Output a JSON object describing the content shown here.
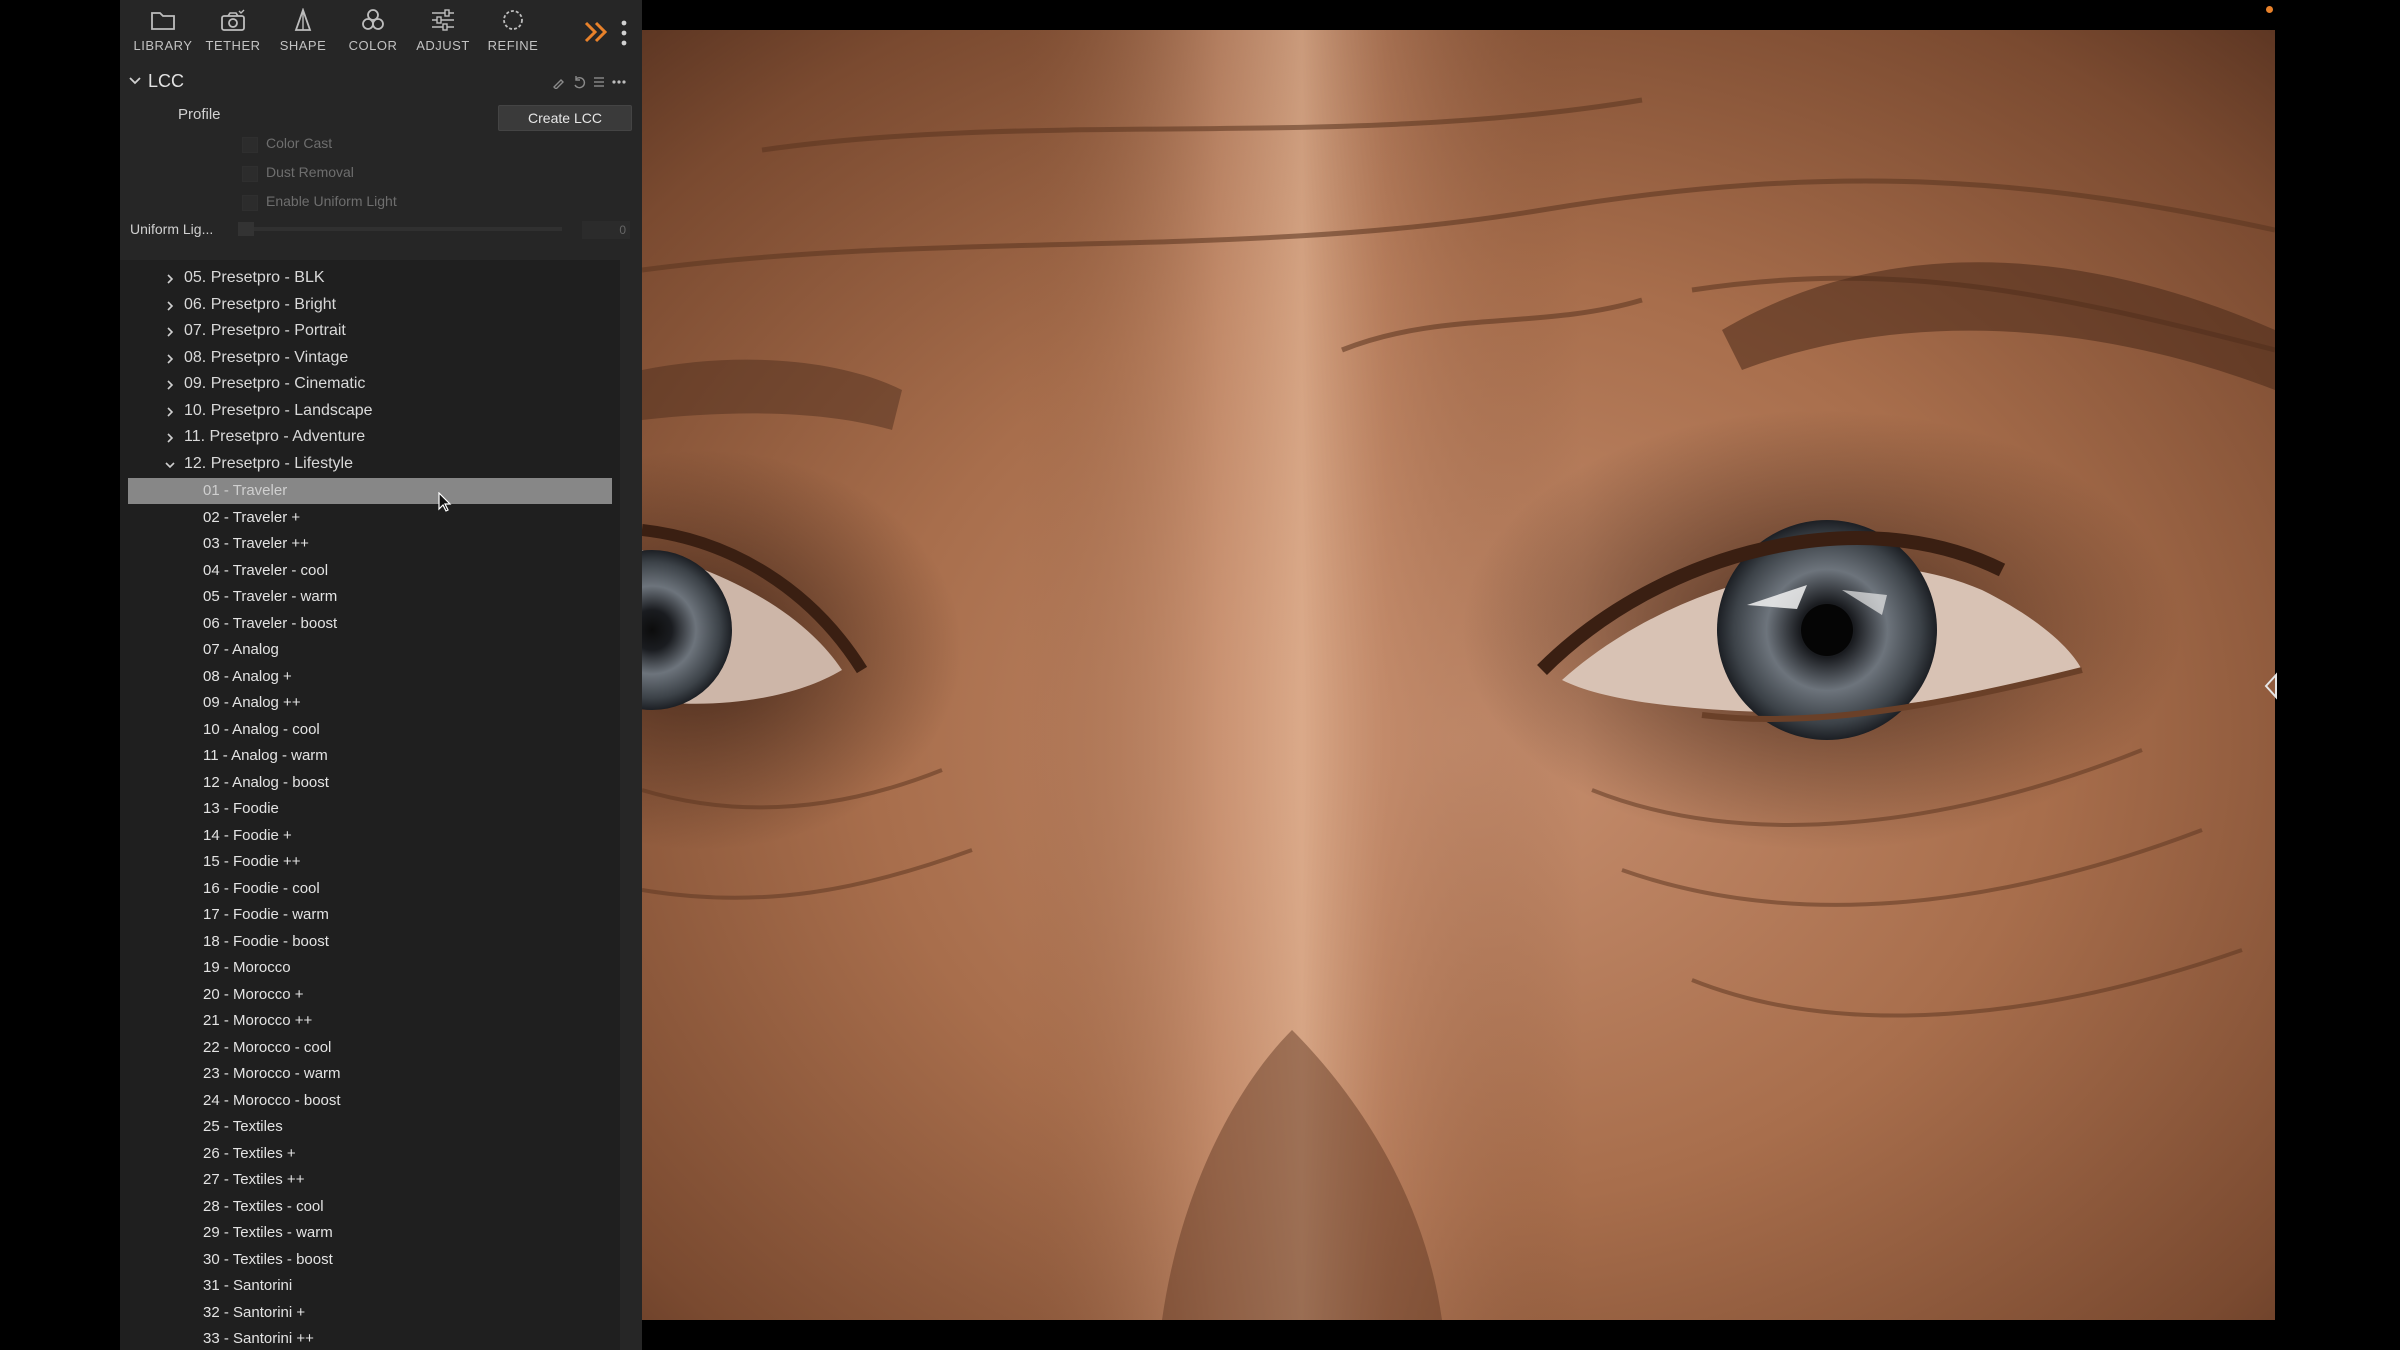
{
  "toolbar": {
    "tabs": [
      {
        "label": "LIBRARY",
        "icon": "folder-icon"
      },
      {
        "label": "TETHER",
        "icon": "camera-icon"
      },
      {
        "label": "SHAPE",
        "icon": "shape-icon"
      },
      {
        "label": "COLOR",
        "icon": "color-circles-icon"
      },
      {
        "label": "ADJUST",
        "icon": "sliders-icon"
      },
      {
        "label": "REFINE",
        "icon": "refine-circle-icon"
      }
    ],
    "accent_color": "#e8812a"
  },
  "lcc": {
    "title": "LCC",
    "profile_label": "Profile",
    "create_button": "Create LCC",
    "options": [
      {
        "label": "Color Cast",
        "checked": false
      },
      {
        "label": "Dust Removal",
        "checked": false
      },
      {
        "label": "Enable Uniform Light",
        "checked": false
      }
    ],
    "uniform_label": "Uniform Lig...",
    "uniform_value": "0"
  },
  "styles": {
    "groups": [
      {
        "label": "05. Presetpro - BLK",
        "expanded": false
      },
      {
        "label": "06. Presetpro - Bright",
        "expanded": false
      },
      {
        "label": "07. Presetpro - Portrait",
        "expanded": false
      },
      {
        "label": "08. Presetpro - Vintage",
        "expanded": false
      },
      {
        "label": "09. Presetpro - Cinematic",
        "expanded": false
      },
      {
        "label": "10. Presetpro - Landscape",
        "expanded": false
      },
      {
        "label": "11. Presetpro - Adventure",
        "expanded": false
      },
      {
        "label": "12. Presetpro - Lifestyle",
        "expanded": true
      }
    ],
    "presets": [
      "01 - Traveler",
      "02 - Traveler +",
      "03 - Traveler ++",
      "04 - Traveler - cool",
      "05 - Traveler - warm",
      "06 - Traveler - boost",
      "07 - Analog",
      "08 - Analog +",
      "09 - Analog ++",
      "10 - Analog - cool",
      "11 - Analog - warm",
      "12 - Analog - boost",
      "13 - Foodie",
      "14 - Foodie +",
      "15 - Foodie ++",
      "16 - Foodie - cool",
      "17 - Foodie - warm",
      "18 - Foodie - boost",
      "19 - Morocco",
      "20 - Morocco +",
      "21 - Morocco ++",
      "22 - Morocco - cool",
      "23 - Morocco - warm",
      "24 - Morocco - boost",
      "25 - Textiles",
      "26 - Textiles +",
      "27 - Textiles ++",
      "28 - Textiles - cool",
      "29 - Textiles - warm",
      "30 - Textiles - boost",
      "31 - Santorini",
      "32 - Santorini +",
      "33 - Santorini ++"
    ],
    "selected_preset": "01 - Traveler"
  },
  "viewer": {
    "image_subject": "close-up-eyes-photo"
  }
}
